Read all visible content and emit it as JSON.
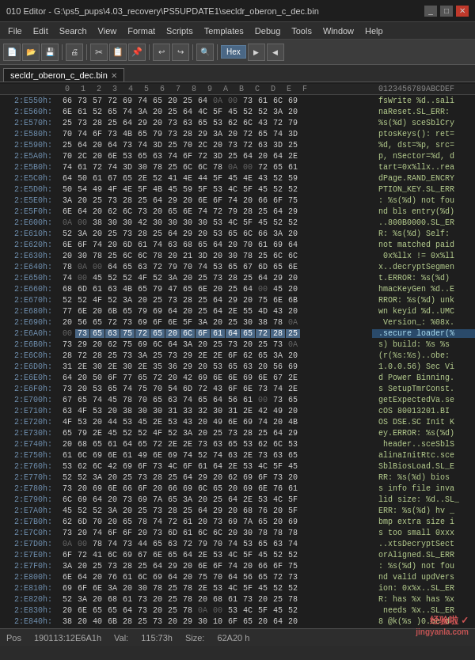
{
  "title_bar": {
    "text": "010 Editor - G:\\ps5_pups\\4.03_recovery\\PS5UPDATE1\\secldr_oberon_c_dec.bin",
    "minimize": "_",
    "maximize": "□",
    "close": "✕"
  },
  "menu": {
    "items": [
      "File",
      "Edit",
      "Search",
      "View",
      "Format",
      "Scripts",
      "Templates",
      "Debug",
      "Tools",
      "Window",
      "Help"
    ]
  },
  "tabs": [
    {
      "label": "secldr_oberon_c_dec.bin",
      "active": true
    }
  ],
  "hex_header": {
    "addr_label": "",
    "cols": [
      "0",
      "1",
      "2",
      "3",
      "4",
      "5",
      "6",
      "7",
      "8",
      "9",
      "A",
      "B",
      "C",
      "D",
      "E",
      "F"
    ],
    "ascii_label": "0123456789ABCDEF"
  },
  "rows": [
    {
      "addr": "2:E550h:",
      "bytes": [
        "66",
        "73",
        "57",
        "72",
        "69",
        "74",
        "65",
        "20",
        "25",
        "64",
        "0A",
        "00",
        "73",
        "61",
        "6C",
        "69"
      ],
      "ascii": "fsWrite %d..sali"
    },
    {
      "addr": "2:E560h:",
      "bytes": [
        "6E",
        "61",
        "52",
        "65",
        "74",
        "3A",
        "20",
        "25",
        "64",
        "4C",
        "5F",
        "45",
        "52",
        "52",
        "3A",
        "20"
      ],
      "ascii": "naReset.SL_ERR:"
    },
    {
      "addr": "2:E570h:",
      "bytes": [
        "25",
        "73",
        "28",
        "25",
        "64",
        "29",
        "20",
        "73",
        "63",
        "65",
        "53",
        "62",
        "6C",
        "43",
        "72",
        "79"
      ],
      "ascii": "%s(%d) sceSblCry"
    },
    {
      "addr": "2:E580h:",
      "bytes": [
        "70",
        "74",
        "6F",
        "73",
        "4B",
        "65",
        "79",
        "73",
        "28",
        "29",
        "3A",
        "20",
        "72",
        "65",
        "74",
        "3D"
      ],
      "ascii": "ptosKeys(): ret="
    },
    {
      "addr": "2:E590h:",
      "bytes": [
        "25",
        "64",
        "20",
        "64",
        "73",
        "74",
        "3D",
        "25",
        "70",
        "2C",
        "20",
        "73",
        "72",
        "63",
        "3D",
        "25"
      ],
      "ascii": "%d, dst=%p, src="
    },
    {
      "addr": "2:E5A0h:",
      "bytes": [
        "70",
        "2C",
        "20",
        "6E",
        "53",
        "65",
        "63",
        "74",
        "6F",
        "72",
        "3D",
        "25",
        "64",
        "20",
        "64",
        "2E"
      ],
      "ascii": "p, nSector=%d, d"
    },
    {
      "addr": "2:E5B0h:",
      "bytes": [
        "74",
        "61",
        "72",
        "74",
        "3D",
        "30",
        "78",
        "25",
        "6C",
        "6C",
        "78",
        "0A",
        "00",
        "72",
        "65",
        "61"
      ],
      "ascii": "tart=0x%llx..rea"
    },
    {
      "addr": "2:E5C0h:",
      "bytes": [
        "64",
        "50",
        "61",
        "67",
        "65",
        "2E",
        "52",
        "41",
        "4E",
        "44",
        "5F",
        "45",
        "4E",
        "43",
        "52",
        "59"
      ],
      "ascii": "dPage.RAND_ENCRY"
    },
    {
      "addr": "2:E5D0h:",
      "bytes": [
        "50",
        "54",
        "49",
        "4F",
        "4E",
        "5F",
        "4B",
        "45",
        "59",
        "5F",
        "53",
        "4C",
        "5F",
        "45",
        "52",
        "52"
      ],
      "ascii": "PTION_KEY.SL_ERR"
    },
    {
      "addr": "2:E5E0h:",
      "bytes": [
        "3A",
        "20",
        "25",
        "73",
        "28",
        "25",
        "64",
        "29",
        "20",
        "6E",
        "6F",
        "74",
        "20",
        "66",
        "6F",
        "75"
      ],
      "ascii": ": %s(%d) not fou"
    },
    {
      "addr": "2:E5F0h:",
      "bytes": [
        "6E",
        "64",
        "20",
        "62",
        "6C",
        "73",
        "20",
        "65",
        "6E",
        "74",
        "72",
        "79",
        "28",
        "25",
        "64",
        "29"
      ],
      "ascii": "nd bls entry(%d)"
    },
    {
      "addr": "2:E600h:",
      "bytes": [
        "0A",
        "00",
        "38",
        "30",
        "30",
        "42",
        "30",
        "30",
        "30",
        "30",
        "53",
        "4C",
        "5F",
        "45",
        "52",
        "52"
      ],
      "ascii": "..800B0000.SL_ER"
    },
    {
      "addr": "2:E610h:",
      "bytes": [
        "52",
        "3A",
        "20",
        "25",
        "73",
        "28",
        "25",
        "64",
        "29",
        "20",
        "53",
        "65",
        "6C",
        "66",
        "3A",
        "20"
      ],
      "ascii": "R: %s(%d) Self: "
    },
    {
      "addr": "2:E620h:",
      "bytes": [
        "6E",
        "6F",
        "74",
        "20",
        "6D",
        "61",
        "74",
        "63",
        "68",
        "65",
        "64",
        "20",
        "70",
        "61",
        "69",
        "64"
      ],
      "ascii": "not matched paid"
    },
    {
      "addr": "2:E630h:",
      "bytes": [
        "20",
        "30",
        "78",
        "25",
        "6C",
        "6C",
        "78",
        "20",
        "21",
        "3D",
        "20",
        "30",
        "78",
        "25",
        "6C",
        "6C"
      ],
      "ascii": " 0x%llx != 0x%ll"
    },
    {
      "addr": "2:E640h:",
      "bytes": [
        "78",
        "0A",
        "00",
        "64",
        "65",
        "63",
        "72",
        "79",
        "70",
        "74",
        "53",
        "65",
        "67",
        "6D",
        "65",
        "6E"
      ],
      "ascii": "x..decryptSegmen"
    },
    {
      "addr": "2:E650h:",
      "bytes": [
        "74",
        "00",
        "45",
        "52",
        "52",
        "4F",
        "52",
        "3A",
        "20",
        "25",
        "73",
        "28",
        "25",
        "64",
        "29",
        "20"
      ],
      "ascii": "t.ERROR: %s(%d) "
    },
    {
      "addr": "2:E660h:",
      "bytes": [
        "68",
        "6D",
        "61",
        "63",
        "4B",
        "65",
        "79",
        "47",
        "65",
        "6E",
        "20",
        "25",
        "64",
        "00",
        "45",
        "20"
      ],
      "ascii": "hmacKeyGen %d..E"
    },
    {
      "addr": "2:E670h:",
      "bytes": [
        "52",
        "52",
        "4F",
        "52",
        "3A",
        "20",
        "25",
        "73",
        "28",
        "25",
        "64",
        "29",
        "20",
        "75",
        "6E",
        "6B"
      ],
      "ascii": "RROR: %s(%d) unk"
    },
    {
      "addr": "2:E680h:",
      "bytes": [
        "77",
        "6E",
        "20",
        "6B",
        "65",
        "79",
        "69",
        "64",
        "20",
        "25",
        "64",
        "2E",
        "55",
        "4D",
        "43",
        "20"
      ],
      "ascii": "wn keyid %d..UMC"
    },
    {
      "addr": "2:E690h:",
      "bytes": [
        "20",
        "56",
        "65",
        "72",
        "73",
        "69",
        "6F",
        "6E",
        "5F",
        "3A",
        "20",
        "25",
        "30",
        "38",
        "78",
        "0A"
      ],
      "ascii": " Version_: %08x."
    },
    {
      "addr": "2:E6A0h:",
      "bytes": [
        "00",
        "73",
        "65",
        "63",
        "75",
        "72",
        "65",
        "20",
        "6C",
        "6F",
        "61",
        "64",
        "65",
        "72",
        "28",
        "25"
      ],
      "ascii": ".secure loader(%",
      "selected": [
        1,
        2,
        3,
        4,
        5,
        6,
        7,
        8,
        9,
        10,
        11,
        12,
        13,
        14,
        15
      ]
    },
    {
      "addr": "2:E6B0h:",
      "bytes": [
        "73",
        "29",
        "20",
        "62",
        "75",
        "69",
        "6C",
        "64",
        "3A",
        "20",
        "25",
        "73",
        "20",
        "25",
        "73",
        "0A"
      ],
      "ascii": "s) build: %s %s"
    },
    {
      "addr": "2:E6C0h:",
      "bytes": [
        "28",
        "72",
        "28",
        "25",
        "73",
        "3A",
        "25",
        "73",
        "29",
        "2E",
        "2E",
        "6F",
        "62",
        "65",
        "3A",
        "20"
      ],
      "ascii": "(r(%s:%s)..obe: "
    },
    {
      "addr": "2:E6D0h:",
      "bytes": [
        "31",
        "2E",
        "30",
        "2E",
        "30",
        "2E",
        "35",
        "36",
        "29",
        "20",
        "53",
        "65",
        "63",
        "20",
        "56",
        "69"
      ],
      "ascii": "1.0.0.56) Sec Vi"
    },
    {
      "addr": "2:E6E0h:",
      "bytes": [
        "64",
        "20",
        "50",
        "6F",
        "77",
        "65",
        "72",
        "20",
        "42",
        "69",
        "6E",
        "6E",
        "69",
        "6E",
        "67",
        "2E"
      ],
      "ascii": "d Power Binning."
    },
    {
      "addr": "2:E6F0h:",
      "bytes": [
        "73",
        "20",
        "53",
        "65",
        "74",
        "75",
        "70",
        "54",
        "6D",
        "72",
        "43",
        "6F",
        "6E",
        "73",
        "74",
        "2E"
      ],
      "ascii": "s SetupTmrConst."
    },
    {
      "addr": "2:E700h:",
      "bytes": [
        "67",
        "65",
        "74",
        "45",
        "78",
        "70",
        "65",
        "63",
        "74",
        "65",
        "64",
        "56",
        "61",
        "00",
        "73",
        "65"
      ],
      "ascii": "getExpectedVa.se"
    },
    {
      "addr": "2:E710h:",
      "bytes": [
        "63",
        "4F",
        "53",
        "20",
        "38",
        "30",
        "30",
        "31",
        "33",
        "32",
        "30",
        "31",
        "2E",
        "42",
        "49",
        "20"
      ],
      "ascii": "cOS 80013201.BI "
    },
    {
      "addr": "2:E720h:",
      "bytes": [
        "4F",
        "53",
        "20",
        "44",
        "53",
        "45",
        "2E",
        "53",
        "43",
        "20",
        "49",
        "6E",
        "69",
        "74",
        "20",
        "4B"
      ],
      "ascii": "OS DSE.SC Init K"
    },
    {
      "addr": "2:E730h:",
      "bytes": [
        "65",
        "79",
        "2E",
        "45",
        "52",
        "52",
        "4F",
        "52",
        "3A",
        "20",
        "25",
        "73",
        "28",
        "25",
        "64",
        "29"
      ],
      "ascii": "ey.ERROR: %s(%d)"
    },
    {
      "addr": "2:E740h:",
      "bytes": [
        "20",
        "68",
        "65",
        "61",
        "64",
        "65",
        "72",
        "2E",
        "2E",
        "73",
        "63",
        "65",
        "53",
        "62",
        "6C",
        "53"
      ],
      "ascii": " header..sceSblS"
    },
    {
      "addr": "2:E750h:",
      "bytes": [
        "61",
        "6C",
        "69",
        "6E",
        "61",
        "49",
        "6E",
        "69",
        "74",
        "52",
        "74",
        "63",
        "2E",
        "73",
        "63",
        "65"
      ],
      "ascii": "alinaInitRtc.sce"
    },
    {
      "addr": "2:E760h:",
      "bytes": [
        "53",
        "62",
        "6C",
        "42",
        "69",
        "6F",
        "73",
        "4C",
        "6F",
        "61",
        "64",
        "2E",
        "53",
        "4C",
        "5F",
        "45"
      ],
      "ascii": "SblBiosLoad.SL_E"
    },
    {
      "addr": "2:E770h:",
      "bytes": [
        "52",
        "52",
        "3A",
        "20",
        "25",
        "73",
        "28",
        "25",
        "64",
        "29",
        "20",
        "62",
        "69",
        "6F",
        "73",
        "20"
      ],
      "ascii": "RR: %s(%d) bios "
    },
    {
      "addr": "2:E780h:",
      "bytes": [
        "73",
        "20",
        "69",
        "6E",
        "66",
        "6F",
        "20",
        "66",
        "69",
        "6C",
        "65",
        "20",
        "69",
        "6E",
        "76",
        "61"
      ],
      "ascii": "s info file inva"
    },
    {
      "addr": "2:E790h:",
      "bytes": [
        "6C",
        "69",
        "64",
        "20",
        "73",
        "69",
        "7A",
        "65",
        "3A",
        "20",
        "25",
        "64",
        "2E",
        "53",
        "4C",
        "5F"
      ],
      "ascii": "lid size: %d..SL_"
    },
    {
      "addr": "2:E7A0h:",
      "bytes": [
        "45",
        "52",
        "52",
        "3A",
        "20",
        "25",
        "73",
        "28",
        "25",
        "64",
        "29",
        "20",
        "68",
        "76",
        "20",
        "5F"
      ],
      "ascii": "ERR: %s(%d) hv _"
    },
    {
      "addr": "2:E7B0h:",
      "bytes": [
        "62",
        "6D",
        "70",
        "20",
        "65",
        "78",
        "74",
        "72",
        "61",
        "20",
        "73",
        "69",
        "7A",
        "65",
        "20",
        "69"
      ],
      "ascii": "bmp extra size i"
    },
    {
      "addr": "2:E7C0h:",
      "bytes": [
        "73",
        "20",
        "74",
        "6F",
        "6F",
        "20",
        "73",
        "6D",
        "61",
        "6C",
        "6C",
        "20",
        "30",
        "78",
        "78",
        "78"
      ],
      "ascii": "s too small 0xxx"
    },
    {
      "addr": "2:E7D0h:",
      "bytes": [
        "0A",
        "00",
        "78",
        "74",
        "73",
        "44",
        "65",
        "63",
        "72",
        "79",
        "70",
        "74",
        "53",
        "65",
        "63",
        "74"
      ],
      "ascii": "..xtsDecryptSect"
    },
    {
      "addr": "2:E7E0h:",
      "bytes": [
        "6F",
        "72",
        "41",
        "6C",
        "69",
        "67",
        "6E",
        "65",
        "64",
        "2E",
        "53",
        "4C",
        "5F",
        "45",
        "52",
        "52"
      ],
      "ascii": "orAligned.SL_ERR"
    },
    {
      "addr": "2:E7F0h:",
      "bytes": [
        "3A",
        "20",
        "25",
        "73",
        "28",
        "25",
        "64",
        "29",
        "20",
        "6E",
        "6F",
        "74",
        "20",
        "66",
        "6F",
        "75"
      ],
      "ascii": ": %s(%d) not fou"
    },
    {
      "addr": "2:E800h:",
      "bytes": [
        "6E",
        "64",
        "20",
        "76",
        "61",
        "6C",
        "69",
        "64",
        "20",
        "75",
        "70",
        "64",
        "56",
        "65",
        "72",
        "73"
      ],
      "ascii": "nd valid updVers"
    },
    {
      "addr": "2:E810h:",
      "bytes": [
        "69",
        "6F",
        "6E",
        "3A",
        "20",
        "30",
        "78",
        "25",
        "78",
        "2E",
        "53",
        "4C",
        "5F",
        "45",
        "52",
        "52"
      ],
      "ascii": "ion: 0x%x..SL_ER"
    },
    {
      "addr": "2:E820h:",
      "bytes": [
        "52",
        "3A",
        "20",
        "68",
        "61",
        "73",
        "20",
        "25",
        "78",
        "20",
        "68",
        "61",
        "73",
        "20",
        "25",
        "78"
      ],
      "ascii": "R: has %x has %x"
    },
    {
      "addr": "2:E830h:",
      "bytes": [
        "20",
        "6E",
        "65",
        "65",
        "64",
        "73",
        "20",
        "25",
        "78",
        "0A",
        "00",
        "53",
        "4C",
        "5F",
        "45",
        "52"
      ],
      "ascii": " needs %x..SL_ER"
    },
    {
      "addr": "2:E840h:",
      "bytes": [
        "38",
        "20",
        "40",
        "6B",
        "28",
        "25",
        "73",
        "20",
        "29",
        "30",
        "10",
        "6F",
        "65",
        "20",
        "64",
        "20"
      ],
      "ascii": "8 @k(%s )0.oe d "
    }
  ],
  "status_bar": {
    "pos_label": "Pos",
    "pos_value": "190113:12E6A1h",
    "val_label": "Val:",
    "val_value": "115:73h",
    "size_label": "Size:",
    "size_value": "62A20 h"
  },
  "watermark": {
    "line1": "经验啦 ✓",
    "line2": "jingyanla.com"
  }
}
